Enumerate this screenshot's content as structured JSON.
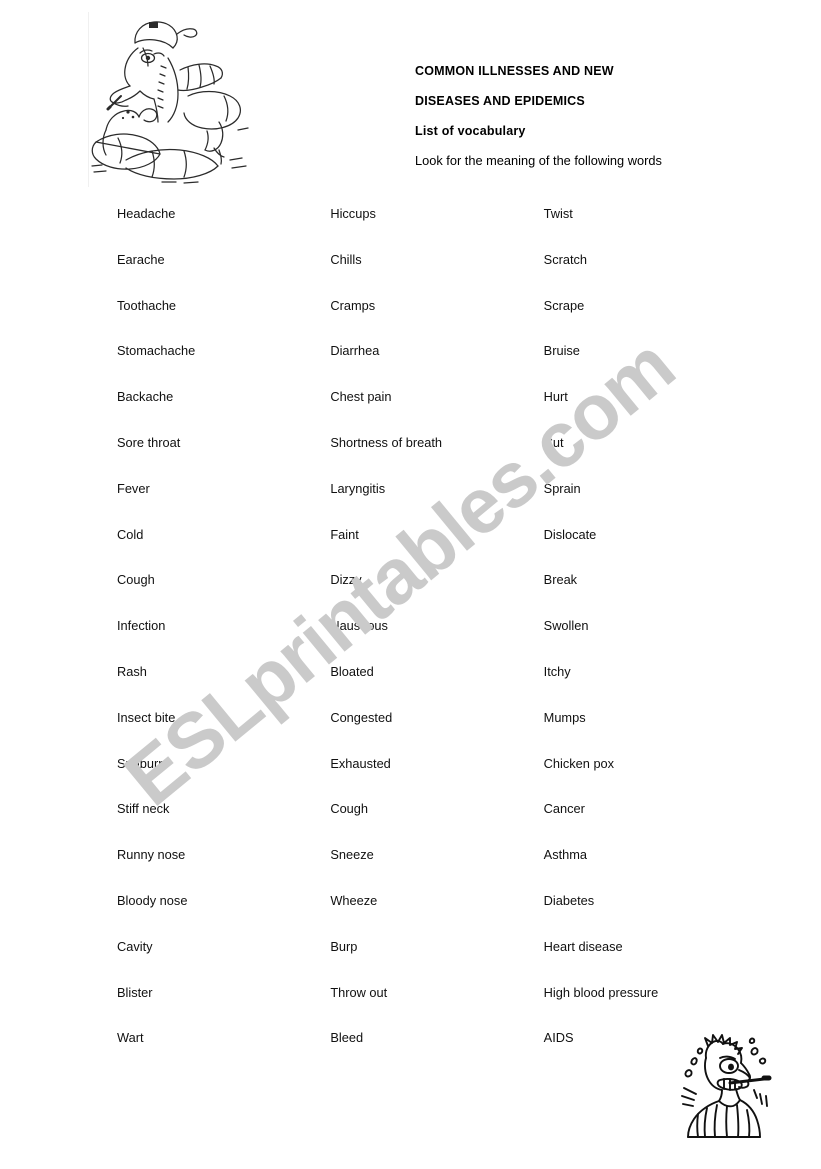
{
  "document": {
    "headings": [
      {
        "text": "COMMON ILLNESSES AND NEW",
        "style": "bold"
      },
      {
        "text": "DISEASES AND EPIDEMICS",
        "style": "bold"
      },
      {
        "text": "List of vocabulary",
        "style": "bold"
      },
      {
        "text": "Look for the meaning of the following words",
        "style": "normal"
      }
    ],
    "watermark": "ESLprintables.com",
    "watermark_color": "#cacaca",
    "text_color": "#111111",
    "background_color": "#ffffff",
    "images": [
      {
        "name": "sick-dragon-in-bed-clipart",
        "position": "top-left"
      },
      {
        "name": "sick-man-with-thermometer-clipart",
        "position": "bottom-right"
      }
    ],
    "vocabulary_rows": [
      [
        "Headache",
        "Hiccups",
        "Twist"
      ],
      [
        "Earache",
        "Chills",
        "Scratch"
      ],
      [
        "Toothache",
        "Cramps",
        "Scrape"
      ],
      [
        "Stomachache",
        "Diarrhea",
        "Bruise"
      ],
      [
        "Backache",
        "Chest pain",
        "Hurt"
      ],
      [
        "Sore throat",
        "Shortness of breath",
        "Cut"
      ],
      [
        "Fever",
        "Laryngitis",
        "Sprain"
      ],
      [
        "Cold",
        "Faint",
        "Dislocate"
      ],
      [
        "Cough",
        "Dizzy",
        "Break"
      ],
      [
        "Infection",
        "Nauseous",
        "Swollen"
      ],
      [
        "Rash",
        "Bloated",
        "Itchy"
      ],
      [
        "Insect bite",
        "Congested",
        "Mumps"
      ],
      [
        "Sunburn",
        "Exhausted",
        "Chicken pox"
      ],
      [
        "Stiff neck",
        "Cough",
        "Cancer"
      ],
      [
        "Runny nose",
        "Sneeze",
        "Asthma"
      ],
      [
        "Bloody nose",
        "Wheeze",
        "Diabetes"
      ],
      [
        "Cavity",
        "Burp",
        "Heart disease"
      ],
      [
        "Blister",
        "Throw out",
        "High blood pressure"
      ],
      [
        "Wart",
        "Bleed",
        "AIDS"
      ]
    ]
  }
}
